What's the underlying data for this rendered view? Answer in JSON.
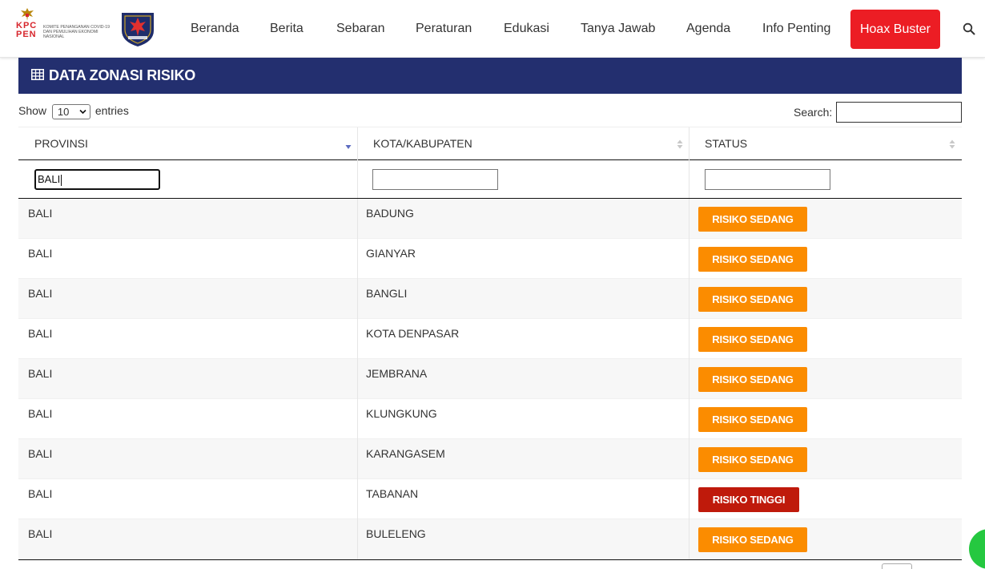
{
  "logo": {
    "letters": "KPC PEN",
    "subtitle": "KOMITE PENANGANAN COVID-19 DAN PEMULIHAN EKONOMI NASIONAL"
  },
  "nav": {
    "items": [
      "Beranda",
      "Berita",
      "Sebaran",
      "Peraturan",
      "Edukasi",
      "Tanya Jawab",
      "Agenda",
      "Info Penting"
    ],
    "hoax_label": "Hoax Buster",
    "search_icon": "search-icon"
  },
  "section": {
    "title": "DATA ZONASI RISIKO",
    "icon": "table-icon",
    "bg_color": "#232f6f"
  },
  "controls": {
    "show_label": "Show",
    "entries_value": "10",
    "entries_label": "entries",
    "search_label": "Search:",
    "search_value": ""
  },
  "table": {
    "columns": [
      "PROVINSI",
      "KOTA/KABUPATEN",
      "STATUS"
    ],
    "sorted_column": "PROVINSI",
    "sort_direction": "descending",
    "filters": [
      "BALI",
      "",
      ""
    ],
    "rows": [
      {
        "provinsi": "BALI",
        "kota": "BADUNG",
        "status": "RISIKO SEDANG"
      },
      {
        "provinsi": "BALI",
        "kota": "GIANYAR",
        "status": "RISIKO SEDANG"
      },
      {
        "provinsi": "BALI",
        "kota": "BANGLI",
        "status": "RISIKO SEDANG"
      },
      {
        "provinsi": "BALI",
        "kota": "KOTA DENPASAR",
        "status": "RISIKO SEDANG"
      },
      {
        "provinsi": "BALI",
        "kota": "JEMBRANA",
        "status": "RISIKO SEDANG"
      },
      {
        "provinsi": "BALI",
        "kota": "KLUNGKUNG",
        "status": "RISIKO SEDANG"
      },
      {
        "provinsi": "BALI",
        "kota": "KARANGASEM",
        "status": "RISIKO SEDANG"
      },
      {
        "provinsi": "BALI",
        "kota": "TABANAN",
        "status": "RISIKO TINGGI"
      },
      {
        "provinsi": "BALI",
        "kota": "BULELENG",
        "status": "RISIKO SEDANG"
      }
    ]
  },
  "colors": {
    "risiko_sedang": "#fb8c00",
    "risiko_tinggi": "#bf1a0b",
    "hoax_button": "#ec1d24"
  }
}
